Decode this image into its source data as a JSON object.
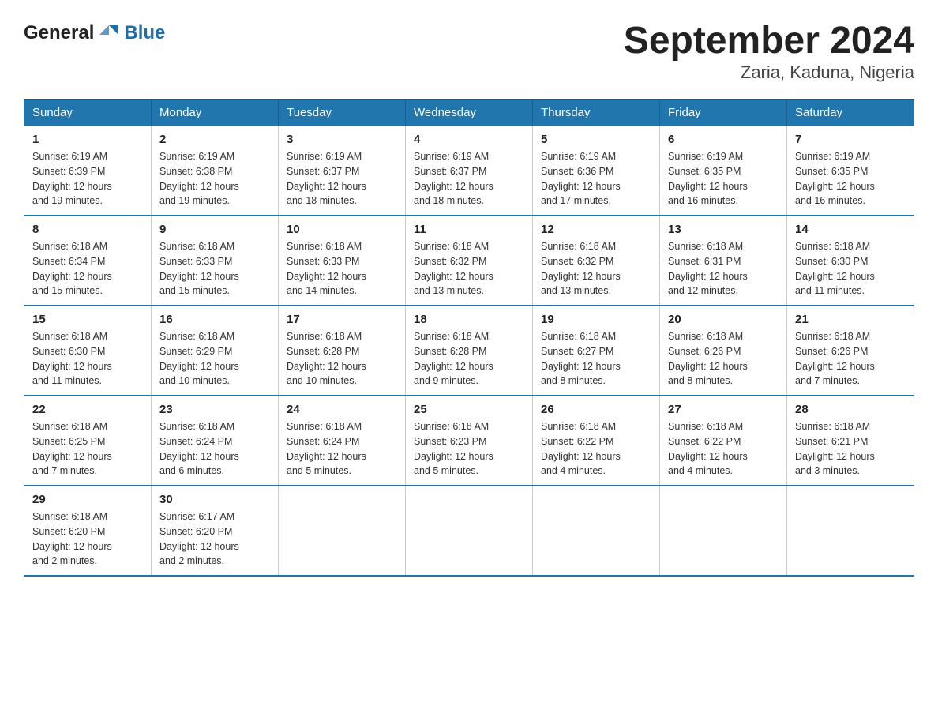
{
  "logo": {
    "general": "General",
    "blue": "Blue"
  },
  "title": "September 2024",
  "subtitle": "Zaria, Kaduna, Nigeria",
  "days_header": [
    "Sunday",
    "Monday",
    "Tuesday",
    "Wednesday",
    "Thursday",
    "Friday",
    "Saturday"
  ],
  "weeks": [
    [
      {
        "day": "1",
        "sunrise": "6:19 AM",
        "sunset": "6:39 PM",
        "daylight": "12 hours and 19 minutes."
      },
      {
        "day": "2",
        "sunrise": "6:19 AM",
        "sunset": "6:38 PM",
        "daylight": "12 hours and 19 minutes."
      },
      {
        "day": "3",
        "sunrise": "6:19 AM",
        "sunset": "6:37 PM",
        "daylight": "12 hours and 18 minutes."
      },
      {
        "day": "4",
        "sunrise": "6:19 AM",
        "sunset": "6:37 PM",
        "daylight": "12 hours and 18 minutes."
      },
      {
        "day": "5",
        "sunrise": "6:19 AM",
        "sunset": "6:36 PM",
        "daylight": "12 hours and 17 minutes."
      },
      {
        "day": "6",
        "sunrise": "6:19 AM",
        "sunset": "6:35 PM",
        "daylight": "12 hours and 16 minutes."
      },
      {
        "day": "7",
        "sunrise": "6:19 AM",
        "sunset": "6:35 PM",
        "daylight": "12 hours and 16 minutes."
      }
    ],
    [
      {
        "day": "8",
        "sunrise": "6:18 AM",
        "sunset": "6:34 PM",
        "daylight": "12 hours and 15 minutes."
      },
      {
        "day": "9",
        "sunrise": "6:18 AM",
        "sunset": "6:33 PM",
        "daylight": "12 hours and 15 minutes."
      },
      {
        "day": "10",
        "sunrise": "6:18 AM",
        "sunset": "6:33 PM",
        "daylight": "12 hours and 14 minutes."
      },
      {
        "day": "11",
        "sunrise": "6:18 AM",
        "sunset": "6:32 PM",
        "daylight": "12 hours and 13 minutes."
      },
      {
        "day": "12",
        "sunrise": "6:18 AM",
        "sunset": "6:32 PM",
        "daylight": "12 hours and 13 minutes."
      },
      {
        "day": "13",
        "sunrise": "6:18 AM",
        "sunset": "6:31 PM",
        "daylight": "12 hours and 12 minutes."
      },
      {
        "day": "14",
        "sunrise": "6:18 AM",
        "sunset": "6:30 PM",
        "daylight": "12 hours and 11 minutes."
      }
    ],
    [
      {
        "day": "15",
        "sunrise": "6:18 AM",
        "sunset": "6:30 PM",
        "daylight": "12 hours and 11 minutes."
      },
      {
        "day": "16",
        "sunrise": "6:18 AM",
        "sunset": "6:29 PM",
        "daylight": "12 hours and 10 minutes."
      },
      {
        "day": "17",
        "sunrise": "6:18 AM",
        "sunset": "6:28 PM",
        "daylight": "12 hours and 10 minutes."
      },
      {
        "day": "18",
        "sunrise": "6:18 AM",
        "sunset": "6:28 PM",
        "daylight": "12 hours and 9 minutes."
      },
      {
        "day": "19",
        "sunrise": "6:18 AM",
        "sunset": "6:27 PM",
        "daylight": "12 hours and 8 minutes."
      },
      {
        "day": "20",
        "sunrise": "6:18 AM",
        "sunset": "6:26 PM",
        "daylight": "12 hours and 8 minutes."
      },
      {
        "day": "21",
        "sunrise": "6:18 AM",
        "sunset": "6:26 PM",
        "daylight": "12 hours and 7 minutes."
      }
    ],
    [
      {
        "day": "22",
        "sunrise": "6:18 AM",
        "sunset": "6:25 PM",
        "daylight": "12 hours and 7 minutes."
      },
      {
        "day": "23",
        "sunrise": "6:18 AM",
        "sunset": "6:24 PM",
        "daylight": "12 hours and 6 minutes."
      },
      {
        "day": "24",
        "sunrise": "6:18 AM",
        "sunset": "6:24 PM",
        "daylight": "12 hours and 5 minutes."
      },
      {
        "day": "25",
        "sunrise": "6:18 AM",
        "sunset": "6:23 PM",
        "daylight": "12 hours and 5 minutes."
      },
      {
        "day": "26",
        "sunrise": "6:18 AM",
        "sunset": "6:22 PM",
        "daylight": "12 hours and 4 minutes."
      },
      {
        "day": "27",
        "sunrise": "6:18 AM",
        "sunset": "6:22 PM",
        "daylight": "12 hours and 4 minutes."
      },
      {
        "day": "28",
        "sunrise": "6:18 AM",
        "sunset": "6:21 PM",
        "daylight": "12 hours and 3 minutes."
      }
    ],
    [
      {
        "day": "29",
        "sunrise": "6:18 AM",
        "sunset": "6:20 PM",
        "daylight": "12 hours and 2 minutes."
      },
      {
        "day": "30",
        "sunrise": "6:17 AM",
        "sunset": "6:20 PM",
        "daylight": "12 hours and 2 minutes."
      },
      null,
      null,
      null,
      null,
      null
    ]
  ],
  "labels": {
    "sunrise": "Sunrise:",
    "sunset": "Sunset:",
    "daylight": "Daylight:"
  }
}
